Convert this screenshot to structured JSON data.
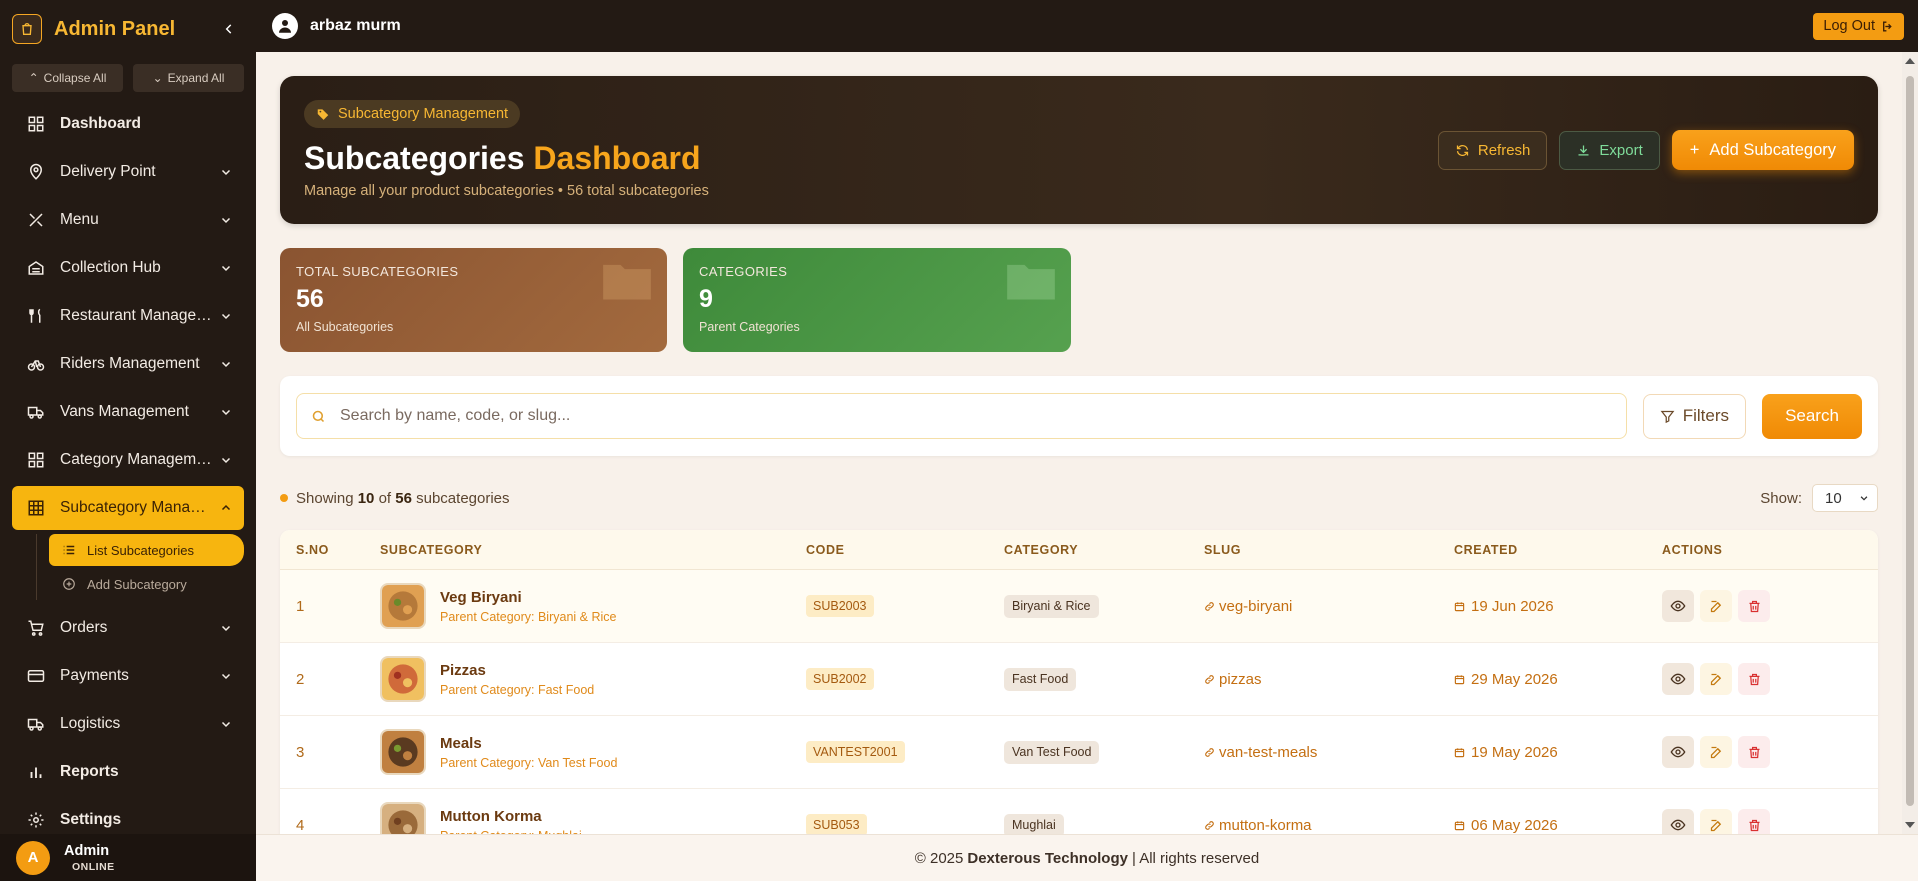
{
  "sidebar": {
    "title": "Admin Panel",
    "collapse_all": "Collapse All",
    "expand_all": "Expand All",
    "items": [
      {
        "label": "Dashboard",
        "icon": "grid-icon",
        "bold": true,
        "chevron": false
      },
      {
        "label": "Delivery Point",
        "icon": "map-pin-icon",
        "chevron": true
      },
      {
        "label": "Menu",
        "icon": "utensils-icon",
        "chevron": true
      },
      {
        "label": "Collection Hub",
        "icon": "building-icon",
        "chevron": true
      },
      {
        "label": "Restaurant Management",
        "icon": "fork-knife-icon",
        "chevron": true
      },
      {
        "label": "Riders Management",
        "icon": "bicycle-icon",
        "chevron": true
      },
      {
        "label": "Vans Management",
        "icon": "truck-icon",
        "chevron": true
      },
      {
        "label": "Category Management",
        "icon": "grid-icon",
        "chevron": true
      },
      {
        "label": "Subcategory Management",
        "icon": "table-icon",
        "chevron": true,
        "active": true
      },
      {
        "label": "Orders",
        "icon": "cart-icon",
        "chevron": true
      },
      {
        "label": "Payments",
        "icon": "card-icon",
        "chevron": true
      },
      {
        "label": "Logistics",
        "icon": "truck-icon",
        "chevron": true
      },
      {
        "label": "Reports",
        "icon": "bar-chart-icon",
        "bold": true,
        "chevron": false
      },
      {
        "label": "Settings",
        "icon": "gear-icon",
        "bold": true,
        "chevron": false
      }
    ],
    "subitems": [
      {
        "label": "List Subcategories",
        "icon": "list-icon",
        "active": true
      },
      {
        "label": "Add Subcategory",
        "icon": "plus-circle-icon",
        "active": false
      }
    ],
    "footer": {
      "avatar": "A",
      "name": "Admin",
      "status": "ONLINE"
    }
  },
  "topbar": {
    "user": "arbaz murm",
    "logout": "Log Out"
  },
  "hero": {
    "tag": "Subcategory Management",
    "title_main": "Subcategories",
    "title_accent": "Dashboard",
    "subtitle": "Manage all your product subcategories • 56 total subcategories",
    "refresh": "Refresh",
    "export": "Export",
    "add": "Add Subcategory"
  },
  "stats": [
    {
      "label": "TOTAL SUBCATEGORIES",
      "value": "56",
      "caption": "All Subcategories",
      "color": "#8a5431"
    },
    {
      "label": "CATEGORIES",
      "value": "9",
      "caption": "Parent Categories",
      "color": "#3e8a3a"
    }
  ],
  "search": {
    "placeholder": "Search by name, code, or slug...",
    "filters": "Filters",
    "button": "Search"
  },
  "listing": {
    "prefix": "Showing",
    "shown": "10",
    "of": "of",
    "total": "56",
    "suffix": "subcategories",
    "show_label": "Show:",
    "show_value": "10"
  },
  "table": {
    "columns": [
      "S.NO",
      "SUBCATEGORY",
      "CODE",
      "CATEGORY",
      "SLUG",
      "CREATED",
      "ACTIONS"
    ],
    "rows": [
      {
        "sno": "1",
        "name": "Veg Biryani",
        "parent": "Parent Category: Biryani & Rice",
        "code": "SUB2003",
        "category": "Biryani & Rice",
        "slug": "veg-biryani",
        "created": "19 Jun 2026"
      },
      {
        "sno": "2",
        "name": "Pizzas",
        "parent": "Parent Category: Fast Food",
        "code": "SUB2002",
        "category": "Fast Food",
        "slug": "pizzas",
        "created": "29 May 2026"
      },
      {
        "sno": "3",
        "name": "Meals",
        "parent": "Parent Category: Van Test Food",
        "code": "VANTEST2001",
        "category": "Van Test Food",
        "slug": "van-test-meals",
        "created": "19 May 2026"
      },
      {
        "sno": "4",
        "name": "Mutton Korma",
        "parent": "Parent Category: Mughlai",
        "code": "SUB053",
        "category": "Mughlai",
        "slug": "mutton-korma",
        "created": "06 May 2026"
      }
    ]
  },
  "footer": {
    "copyright": "© 2025",
    "company": "Dexterous Technology",
    "rights": "| All rights reserved"
  },
  "colors": {
    "accent": "#f39c12",
    "sidebar_bg": "#231a14",
    "active_nav": "#f7b50f"
  }
}
